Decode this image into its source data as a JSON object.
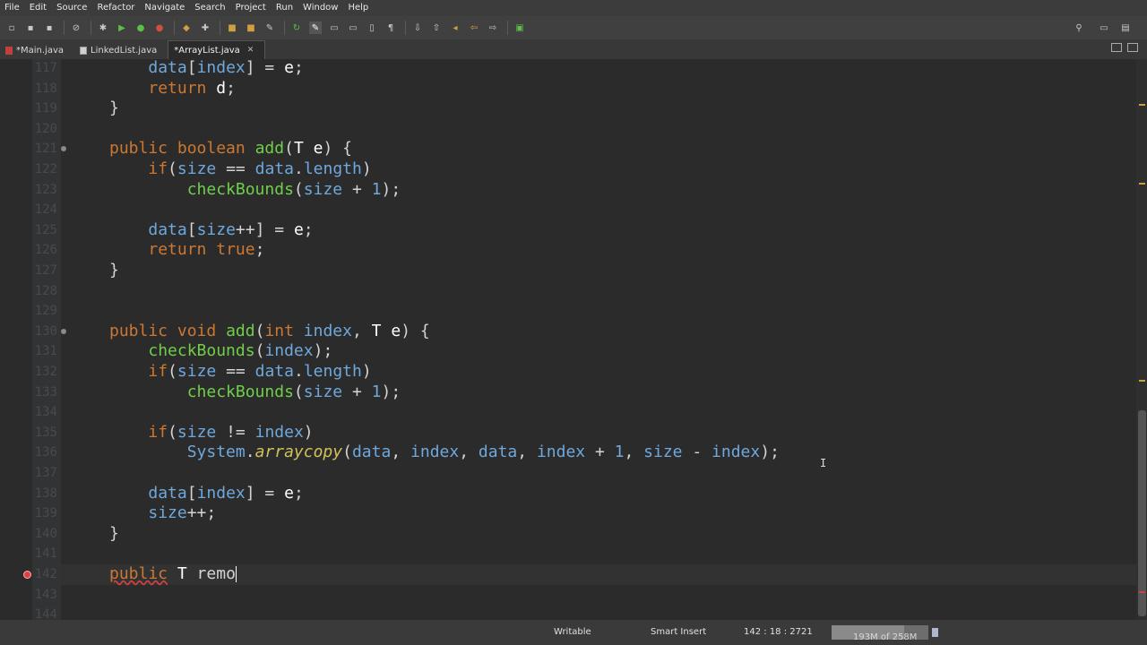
{
  "menu": [
    "File",
    "Edit",
    "Source",
    "Refactor",
    "Navigate",
    "Search",
    "Project",
    "Run",
    "Window",
    "Help"
  ],
  "tabs": [
    {
      "label": "*Main.java",
      "active": false
    },
    {
      "label": "LinkedList.java",
      "active": false
    },
    {
      "label": "*ArrayList.java",
      "active": true
    }
  ],
  "editor": {
    "line_numbers": [
      "117",
      "118",
      "119",
      "120",
      "121",
      "122",
      "123",
      "124",
      "125",
      "126",
      "127",
      "128",
      "129",
      "130",
      "131",
      "132",
      "133",
      "134",
      "135",
      "136",
      "137",
      "138",
      "139",
      "140",
      "141",
      "142",
      "143",
      "144"
    ],
    "lines": [
      "        data[index] = e;",
      "        return d;",
      "    }",
      "",
      "    public boolean add(T e) {",
      "        if(size == data.length)",
      "            checkBounds(size + 1);",
      "",
      "        data[size++] = e;",
      "        return true;",
      "    }",
      "",
      "",
      "    public void add(int index, T e) {",
      "        checkBounds(index);",
      "        if(size == data.length)",
      "            checkBounds(size + 1);",
      "",
      "        if(size != index)",
      "            System.arraycopy(data, index, data, index + 1, size - index);",
      "",
      "        data[index] = e;",
      "        size++;",
      "    }",
      "",
      "    public T remo",
      "",
      ""
    ]
  },
  "statusbar": {
    "mode": "Writable",
    "insert": "Smart Insert",
    "position": "142 : 18 : 2721",
    "heap": "193M of 258M",
    "heap_used_fraction": 0.75
  }
}
